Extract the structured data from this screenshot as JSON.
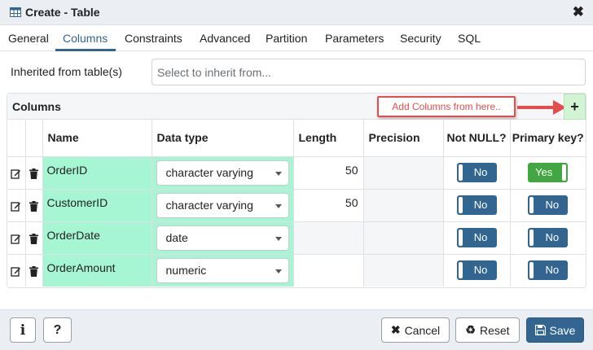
{
  "dialog": {
    "title": "Create - Table",
    "close_icon": "close-icon"
  },
  "tabs": [
    {
      "label": "General"
    },
    {
      "label": "Columns",
      "active": true
    },
    {
      "label": "Constraints"
    },
    {
      "label": "Advanced"
    },
    {
      "label": "Partition"
    },
    {
      "label": "Parameters"
    },
    {
      "label": "Security"
    },
    {
      "label": "SQL"
    }
  ],
  "inherit": {
    "label": "Inherited from table(s)",
    "placeholder": "Select to inherit from..."
  },
  "columns_panel": {
    "title": "Columns",
    "add_label": "+",
    "callout": "Add Columns from here..",
    "callout_color": "#e84b4b"
  },
  "table": {
    "headers": [
      "Name",
      "Data type",
      "Length",
      "Precision",
      "Not NULL?",
      "Primary key?"
    ],
    "rows": [
      {
        "name": "OrderID",
        "data_type": "character varying",
        "length": "50",
        "precision": "",
        "not_null": "No",
        "primary_key": "Yes"
      },
      {
        "name": "CustomerID",
        "data_type": "character varying",
        "length": "50",
        "precision": "",
        "not_null": "No",
        "primary_key": "No"
      },
      {
        "name": "OrderDate",
        "data_type": "date",
        "length": "",
        "precision": "",
        "not_null": "No",
        "primary_key": "No"
      },
      {
        "name": "OrderAmount",
        "data_type": "numeric",
        "length": "",
        "precision": "",
        "not_null": "No",
        "primary_key": "No"
      }
    ]
  },
  "footer": {
    "info_label": "i",
    "help_label": "?",
    "cancel_label": "Cancel",
    "reset_label": "Reset",
    "save_label": "Save"
  },
  "colors": {
    "accent": "#326690",
    "toggle_yes": "#42a642",
    "highlight": "#a6f6d4"
  }
}
